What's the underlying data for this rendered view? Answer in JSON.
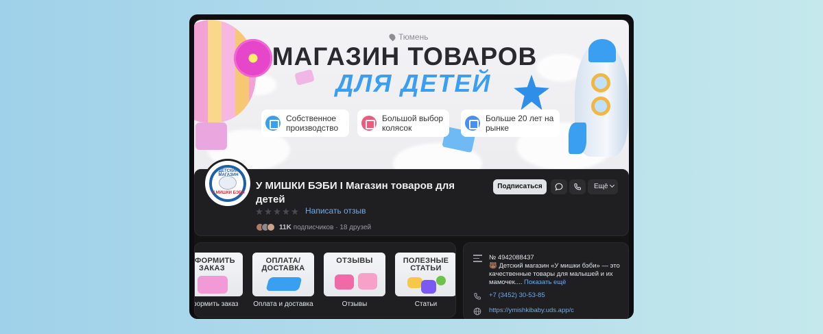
{
  "banner": {
    "location": "Тюмень",
    "title": "МАГАЗИН ТОВАРОВ",
    "subtitle": "ДЛЯ ДЕТЕЙ",
    "features": [
      {
        "label": "Собственное производство",
        "line1": "Собственное",
        "line2": "производство",
        "icon": "factory-icon",
        "color": "#3a9ff0"
      },
      {
        "label": "Большой выбор колясок",
        "line1": "Большой выбор",
        "line2": "колясок",
        "icon": "stroller-icon",
        "color": "#f0597a"
      },
      {
        "label": "Больше 20 лет на рынке",
        "line1": "Больше 20 лет на",
        "line2": "рынке",
        "icon": "shield-check-icon",
        "color": "#4a8ef0"
      }
    ]
  },
  "profile": {
    "avatar_top_text": "ДЕТСКИЙ МАГАЗИН",
    "avatar_bottom_text": "У МИШКИ БЭБИ",
    "name": "У МИШКИ БЭБИ I Магазин товаров для детей",
    "review_link": "Написать отзыв",
    "followers_count": "11K",
    "followers_suffix": "подписчиков · 18 друзей",
    "subscribe_button": "Подписаться",
    "more_button": "Ещё"
  },
  "menu": {
    "tiles": [
      {
        "thumb_title": "ОФОРМИТЬ ЗАКАЗ",
        "label": "Оформить заказ"
      },
      {
        "thumb_title": "ОПЛАТА/ ДОСТАВКА",
        "label": "Оплата и доставка"
      },
      {
        "thumb_title": "ОТЗЫВЫ",
        "label": "Отзывы"
      },
      {
        "thumb_title": "ПОЛЕЗНЫЕ СТАТЬИ",
        "label": "Статьи"
      }
    ]
  },
  "info": {
    "id_line": "№ 4942088437",
    "description": "🐻 Детский магазин «У мишки бэби» — это качественные товары для малышей и их мамочек....",
    "show_more": "Показать ещё",
    "phone": "+7 (3452) 30-53-85",
    "website": "https://ymishkibaby.uds.app/c"
  }
}
